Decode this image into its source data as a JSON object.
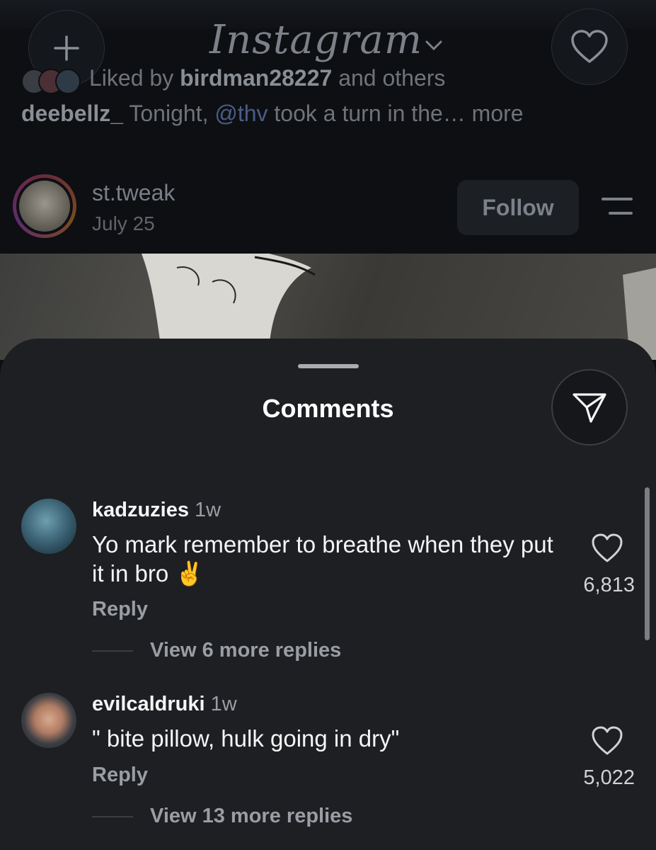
{
  "header": {
    "brand": "Instagram",
    "icons": {
      "new_post": "plus-icon",
      "notifications": "heart-icon",
      "brand_menu": "chevron-down-icon"
    }
  },
  "feed_post_above": {
    "liked_by_prefix": "Liked by ",
    "liked_by_user": "birdman28227",
    "liked_by_suffix": " and others",
    "caption_user": "deebellz_",
    "caption_before_mention": " Tonight, ",
    "caption_mention": "@thv",
    "caption_after_mention": " took a turn in the… ",
    "caption_more": "more"
  },
  "post": {
    "username": "st.tweak",
    "date": "July 25",
    "follow_label": "Follow"
  },
  "comments_sheet": {
    "title": "Comments",
    "comments": [
      {
        "username": "kadzuzies",
        "time": "1w",
        "text": "Yo mark remember to breathe when they put it in bro ✌️",
        "reply_label": "Reply",
        "view_replies": "View 6 more replies",
        "likes": "6,813"
      },
      {
        "username": "evilcaldruki",
        "time": "1w",
        "text": "\" bite pillow, hulk going in dry\"",
        "reply_label": "Reply",
        "view_replies": "View 13 more replies",
        "likes": "5,022"
      }
    ]
  },
  "colors": {
    "sheet_bg": "#1d1f23",
    "text": "#f5f5f5",
    "muted": "#9a9da3",
    "mention": "#4b5c88"
  }
}
